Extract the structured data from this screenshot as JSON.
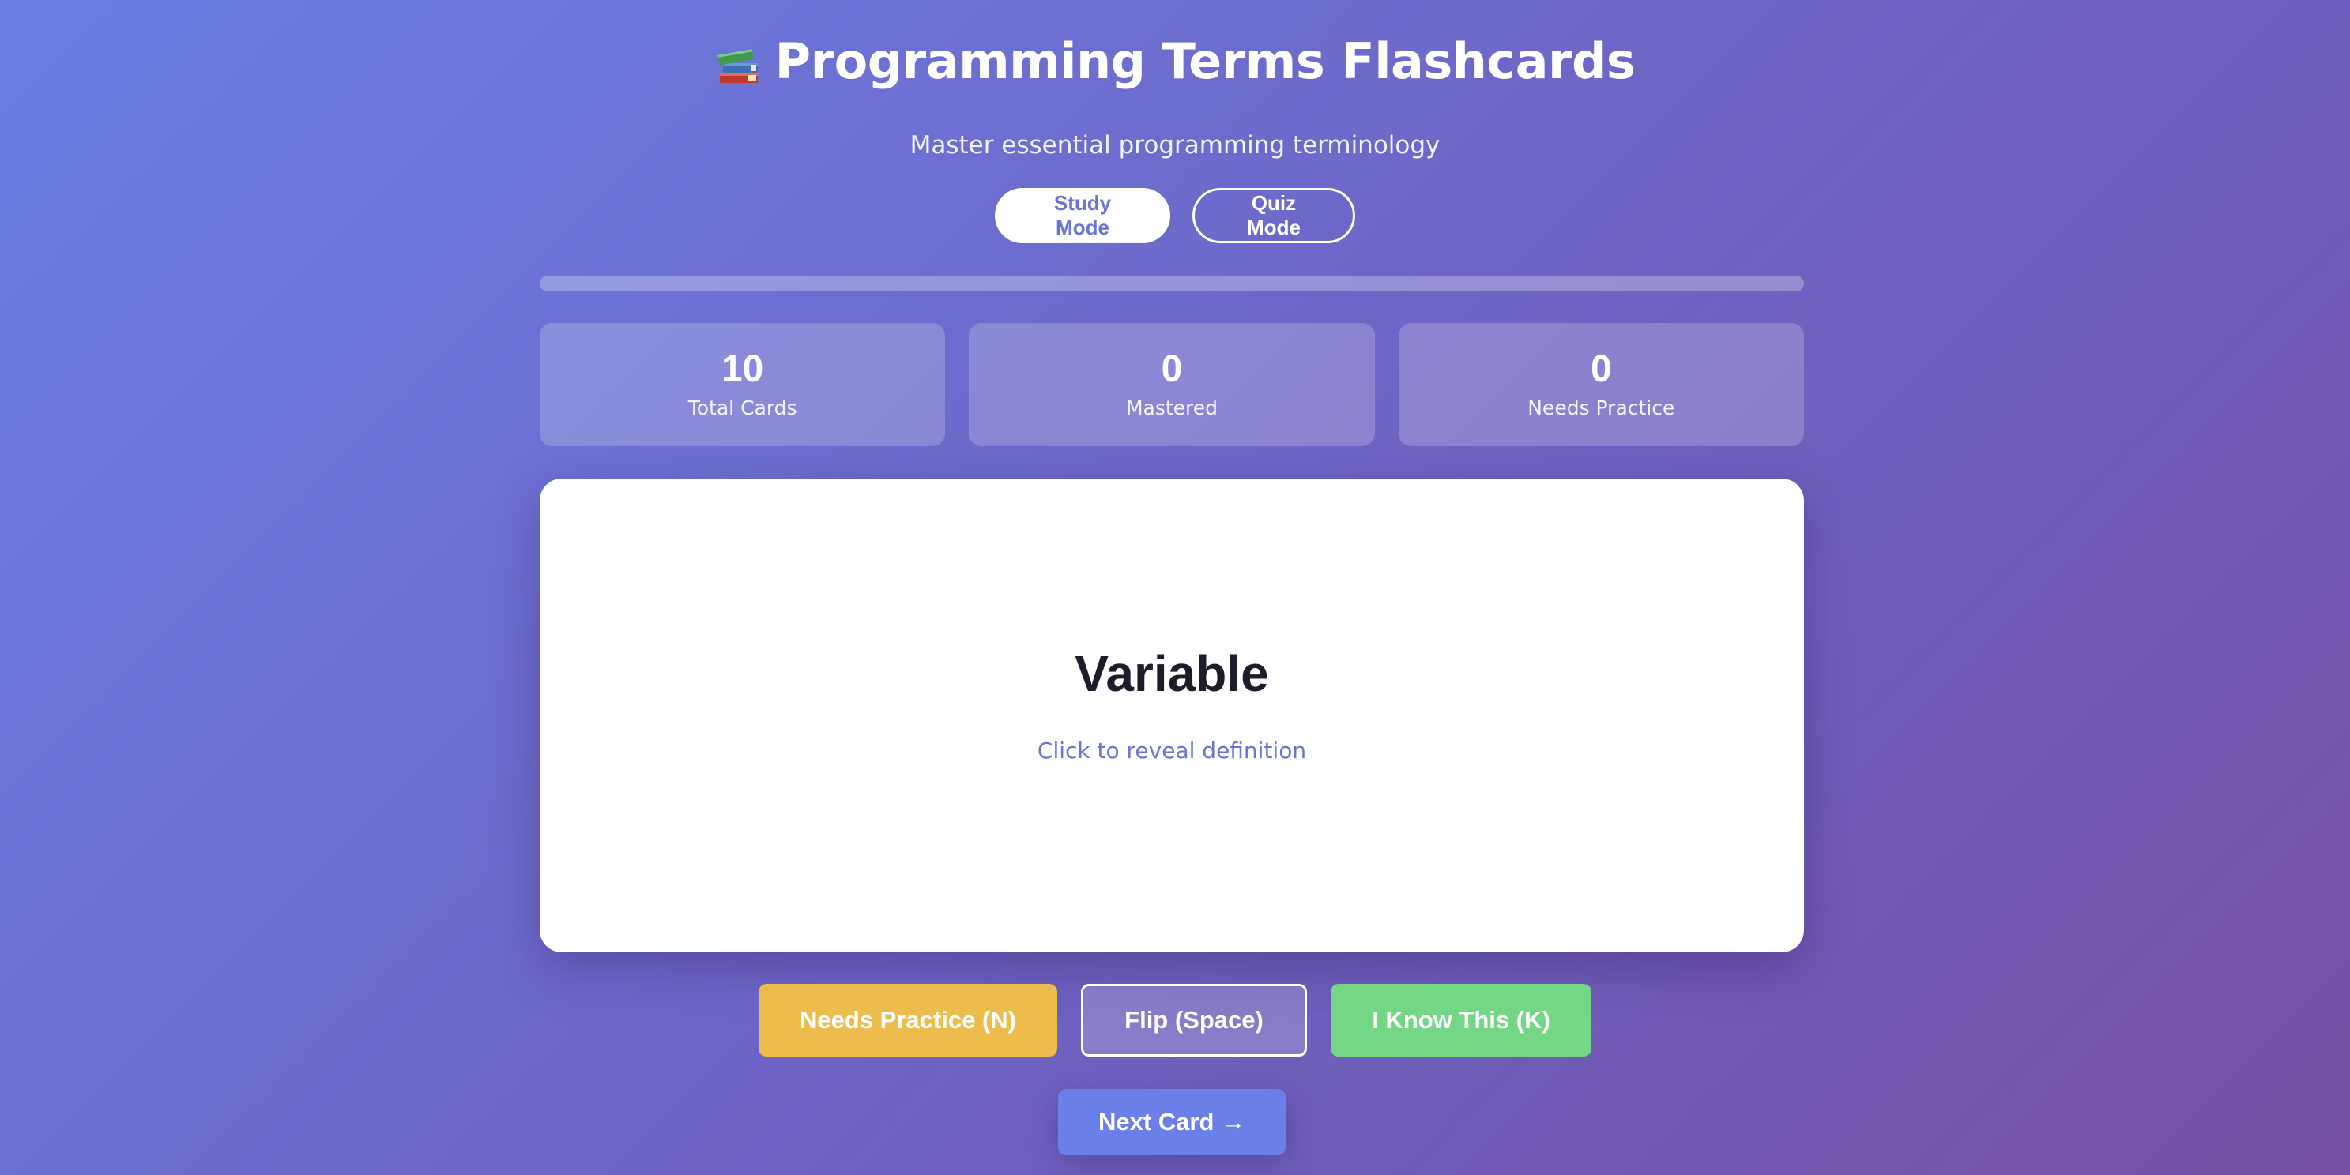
{
  "header": {
    "title": "Programming Terms Flashcards",
    "title_icon": "books-icon",
    "subtitle": "Master essential programming terminology"
  },
  "modes": {
    "study_label": "Study Mode",
    "quiz_label": "Quiz Mode",
    "active": "Study Mode"
  },
  "progress": {
    "percent": 0
  },
  "stats": [
    {
      "value": "10",
      "label": "Total Cards"
    },
    {
      "value": "0",
      "label": "Mastered"
    },
    {
      "value": "0",
      "label": "Needs Practice"
    }
  ],
  "card": {
    "term": "Variable",
    "hint": "Click to reveal definition"
  },
  "actions": {
    "needs_practice_label": "Needs Practice (N)",
    "flip_label": "Flip (Space)",
    "know_label": "I Know This (K)",
    "next_label": "Next Card →"
  },
  "colors": {
    "accent": "#6a73d6",
    "practice": "#ecbd4c",
    "know": "#74d786",
    "next": "#6a7fe8"
  }
}
